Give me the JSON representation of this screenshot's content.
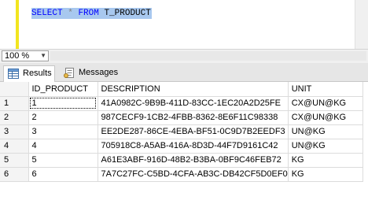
{
  "editor": {
    "sql_keyword_select": "SELECT",
    "sql_star": "*",
    "sql_keyword_from": "FROM",
    "sql_table": "T_PRODUCT"
  },
  "zoom": {
    "value": "100 %"
  },
  "tabs": [
    {
      "label": "Results",
      "icon": "grid-icon"
    },
    {
      "label": "Messages",
      "icon": "messages-icon"
    }
  ],
  "grid": {
    "columns": [
      "ID_PRODUCT",
      "DESCRIPTION",
      "UNIT"
    ],
    "rows": [
      {
        "num": "1",
        "id": "1",
        "description": "41A0982C-9B9B-411D-83CC-1EC20A2D25FE",
        "unit": "CX@UN@KG"
      },
      {
        "num": "2",
        "id": "2",
        "description": "987CECF9-1CB2-4FBB-8362-8E6F11C98338",
        "unit": "CX@UN@KG"
      },
      {
        "num": "3",
        "id": "3",
        "description": "EE2DE287-86CE-4EBA-BF51-0C9D7B2EEDF3",
        "unit": "UN@KG"
      },
      {
        "num": "4",
        "id": "4",
        "description": "705918C8-A5AB-416A-8D3D-44F7D9161C42",
        "unit": "UN@KG"
      },
      {
        "num": "5",
        "id": "5",
        "description": "A61E3ABF-916D-48B2-B3BA-0BF9C46FEB72",
        "unit": "KG"
      },
      {
        "num": "6",
        "id": "6",
        "description": "7A7C27FC-C5BD-4CFA-AB3C-DB42CF5D0EF0",
        "unit": "KG"
      }
    ]
  }
}
